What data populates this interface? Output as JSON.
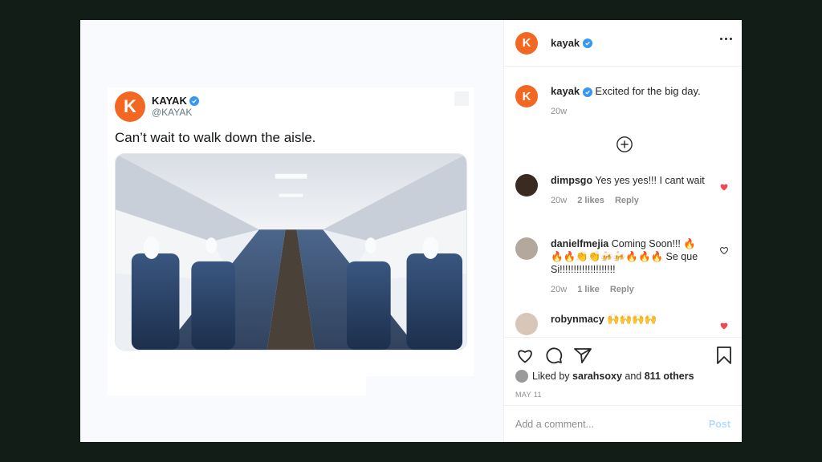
{
  "tweet": {
    "name": "KAYAK",
    "handle": "@KAYAK",
    "avatar_letter": "K",
    "text": "Can’t wait to walk down the aisle."
  },
  "post": {
    "username": "kayak",
    "avatar_letter": "K",
    "caption": "Excited for the big day.",
    "caption_time": "20w",
    "brand_color": "#f26722",
    "verified_color": "#3897f0",
    "like_color": "#ed4956"
  },
  "comments": [
    {
      "user": "dimpsgo",
      "text": "Yes yes yes!!! I cant wait",
      "time": "20w",
      "likes": "2 likes",
      "reply": "Reply",
      "liked": true
    },
    {
      "user": "danielfmejia",
      "text": "Coming Soon!!! 🔥🔥🔥👏👏🍻🍻🔥🔥🔥 Se que Si!!!!!!!!!!!!!!!!!!!!",
      "time": "20w",
      "likes": "1 like",
      "reply": "Reply",
      "liked": false
    },
    {
      "user": "robynmacy",
      "text": "🙌🙌🙌🙌",
      "liked": true
    }
  ],
  "actions": {
    "liked_by_prefix": "Liked by",
    "liked_by_user": "sarahsoxy",
    "liked_by_and": "and",
    "others": "811 others",
    "date": "MAY 11"
  },
  "comment_box": {
    "placeholder": "Add a comment...",
    "post_label": "Post"
  }
}
